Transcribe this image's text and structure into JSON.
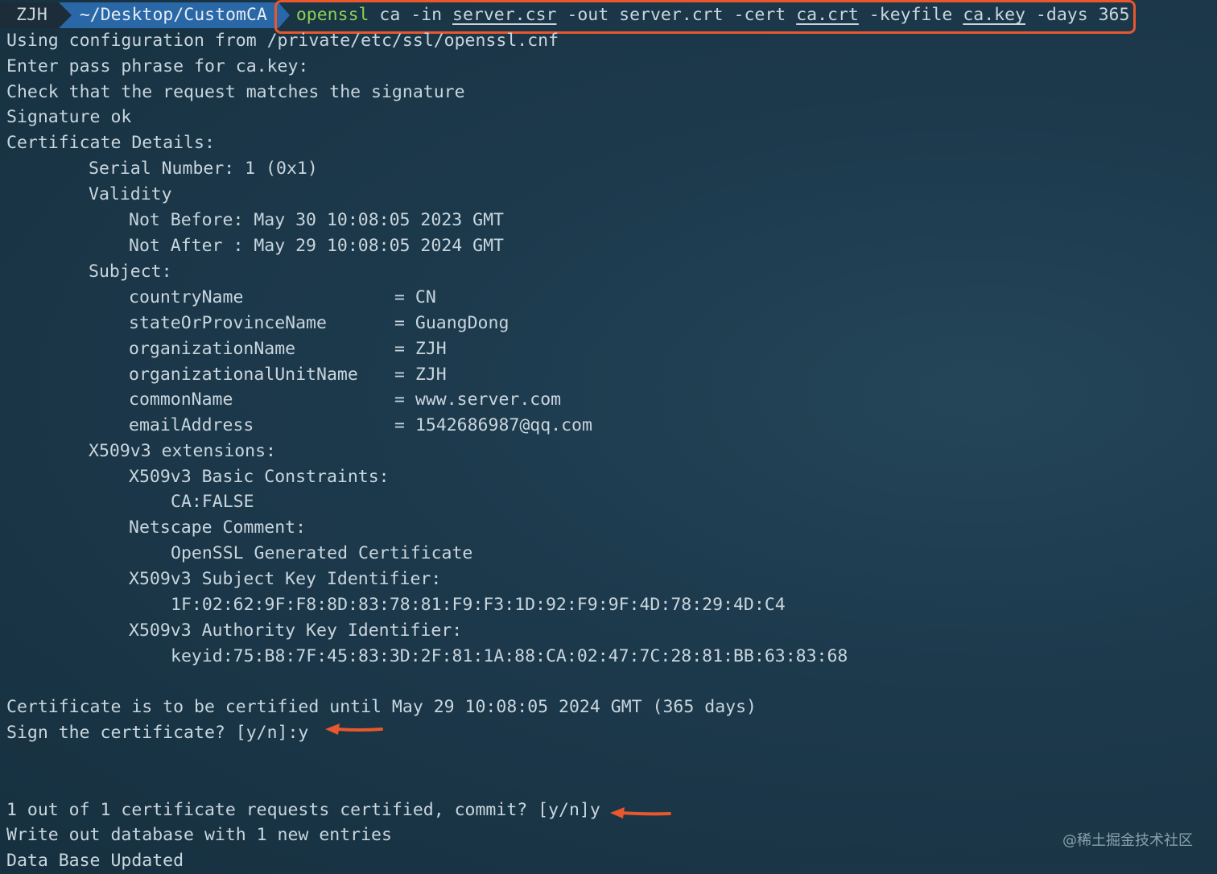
{
  "prompt": {
    "user": "ZJH",
    "dir": "~/Desktop/CustomCA",
    "cmd": {
      "bin": "openssl",
      "t1": " ca -in ",
      "csr": "server.csr",
      "t2": " -out server.crt -cert ",
      "cert": "ca.crt",
      "t3": " -keyfile ",
      "key": "ca.key",
      "t4": " -days 365"
    }
  },
  "output": {
    "using_config": "Using configuration from /private/etc/ssl/openssl.cnf",
    "enter_pass": "Enter pass phrase for ca.key:",
    "check_request": "Check that the request matches the signature",
    "signature_ok": "Signature ok",
    "cert_details": "Certificate Details:",
    "serial": "Serial Number: 1 (0x1)",
    "validity": "Validity",
    "not_before": "Not Before: May 30 10:08:05 2023 GMT",
    "not_after": "Not After : May 29 10:08:05 2024 GMT",
    "subject": "Subject:",
    "subject_fields": [
      {
        "k": "countryName",
        "v": "= CN"
      },
      {
        "k": "stateOrProvinceName",
        "v": "= GuangDong"
      },
      {
        "k": "organizationName",
        "v": "= ZJH"
      },
      {
        "k": "organizationalUnitName",
        "v": "= ZJH"
      },
      {
        "k": "commonName",
        "v": "= www.server.com"
      },
      {
        "k": "emailAddress",
        "v": "= 1542686987@qq.com"
      }
    ],
    "ext": "X509v3 extensions:",
    "basic_constraints": "X509v3 Basic Constraints:",
    "ca_false": "CA:FALSE",
    "netscape_comment": "Netscape Comment:",
    "openssl_generated": "OpenSSL Generated Certificate",
    "ski": "X509v3 Subject Key Identifier:",
    "ski_value": "1F:02:62:9F:F8:8D:83:78:81:F9:F3:1D:92:F9:9F:4D:78:29:4D:C4",
    "aki": "X509v3 Authority Key Identifier:",
    "aki_value": "keyid:75:B8:7F:45:83:3D:2F:81:1A:88:CA:02:47:7C:28:81:BB:63:83:68",
    "certified_until": "Certificate is to be certified until May 29 10:08:05 2024 GMT (365 days)",
    "sign_prompt": "Sign the certificate? [y/n]:y",
    "commit_prompt": "1 out of 1 certificate requests certified, commit? [y/n]y",
    "write_db": "Write out database with 1 new entries",
    "db_updated": "Data Base Updated"
  },
  "watermark": "@稀土掘金技术社区",
  "colors": {
    "background": "#1d3a4d",
    "highlight": "#e8582c",
    "command_green": "#8fd14f",
    "path_blue": "#2a67a6"
  }
}
